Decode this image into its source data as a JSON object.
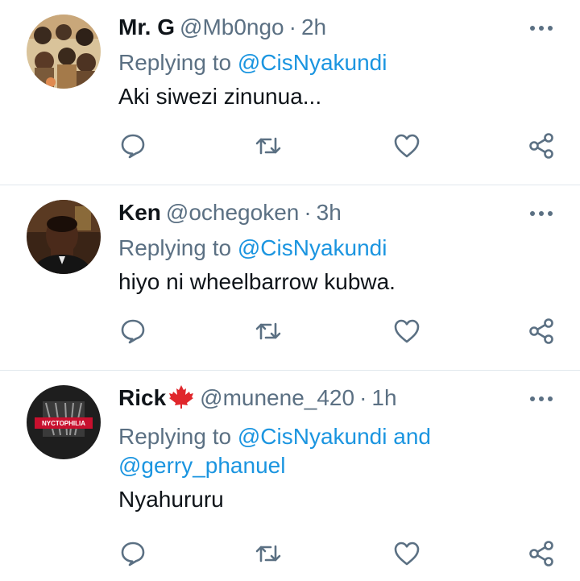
{
  "tweets": [
    {
      "name": "Mr. G",
      "flag": "",
      "handle": "@Mb0ngo",
      "separator": "·",
      "time": "2h",
      "replying_prefix": "Replying to",
      "mentions": [
        "@CisNyakundi"
      ],
      "joiner": "",
      "text": "Aki siwezi zinunua..."
    },
    {
      "name": "Ken",
      "flag": "",
      "handle": "@ochegoken",
      "separator": "·",
      "time": "3h",
      "replying_prefix": "Replying to",
      "mentions": [
        "@CisNyakundi"
      ],
      "joiner": "",
      "text": "hiyo ni wheelbarrow kubwa."
    },
    {
      "name": "Rick",
      "flag": "canada-maple-leaf-emoji",
      "handle": "@munene_420",
      "separator": "·",
      "time": "1h",
      "replying_prefix": "Replying to",
      "mentions": [
        "@CisNyakundi",
        "@gerry_phanuel"
      ],
      "joiner": "and",
      "text": "Nyahururu",
      "avatar_text": "NYCTOPHILIA"
    }
  ],
  "icons": {
    "more": "more-horizontal-icon",
    "reply": "reply-bubble-icon",
    "retweet": "retweet-icon",
    "like": "heart-icon",
    "share": "share-icon"
  },
  "colors": {
    "secondary_text": "#5b7083",
    "link": "#1b95e0",
    "primary_text": "#0f1419",
    "divider": "#e1e8ed",
    "flag_red": "#e0262b"
  }
}
